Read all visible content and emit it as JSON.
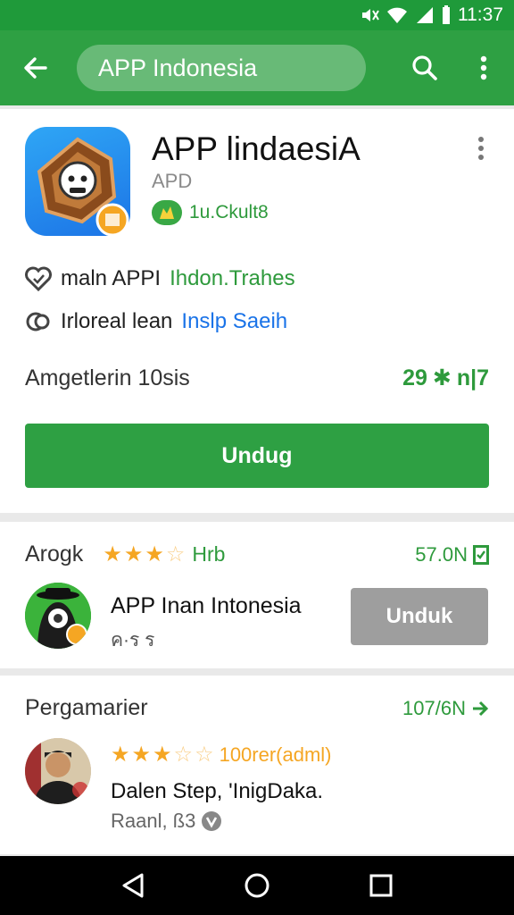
{
  "status_bar": {
    "time": "11:37"
  },
  "app_bar": {
    "search_text": "APP Indonesia"
  },
  "app": {
    "title": "APP lindaesiA",
    "developer": "APD",
    "badge_text": "1u.Ckult8",
    "info": [
      {
        "text": "maln APPI",
        "link": "Ihdon.Trahes"
      },
      {
        "text": "Irloreal lean",
        "link": "Inslp Saeih"
      }
    ],
    "meta_left": "Amgetlerin 10sis",
    "rating_left": "29",
    "rating_right": "n|7",
    "install_label": "Undug"
  },
  "similar": {
    "title": "Arogk",
    "stars_filled": 3,
    "stars_total": 5,
    "extra": "Hrb",
    "right": "57.0N",
    "app_name": "APP Inan Intonesia",
    "tags": "ค·ร ร",
    "button_label": "Unduk"
  },
  "reviews": {
    "title": "Pergamarier",
    "right": "107/6N",
    "stars_filled": 3,
    "stars_total": 5,
    "stars_text": "100rer(adml)",
    "text": "Dalen Step, 'InigDaka.",
    "author": "Raanl, ß3"
  },
  "colors": {
    "primary": "#2ea043",
    "status": "#1f9a3a",
    "star": "#f5a623",
    "disabled": "#9e9e9e"
  },
  "icons": [
    "back-arrow-icon",
    "search-icon",
    "more-vert-icon",
    "badge-icon",
    "heart-icon",
    "link-icon",
    "star-icon",
    "arrow-right-icon",
    "home-circle-icon",
    "recents-square-icon"
  ]
}
